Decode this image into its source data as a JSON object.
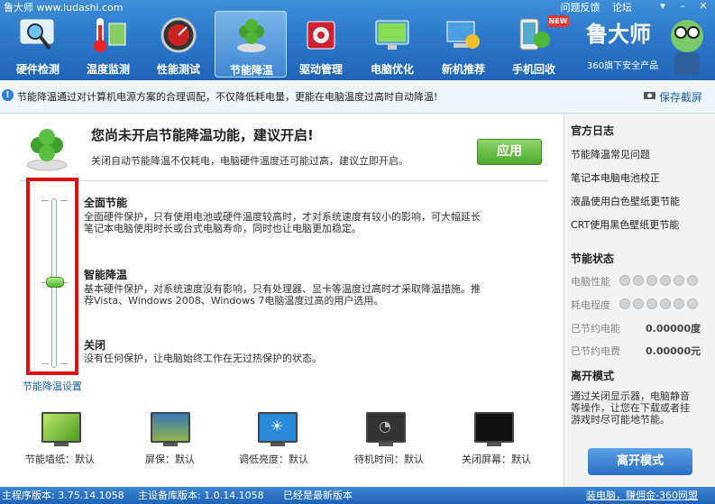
{
  "window": {
    "title": "鲁大师  www.ludashi.com",
    "top_links": [
      "问题反馈",
      "论坛"
    ]
  },
  "nav": [
    {
      "label": "硬件检测"
    },
    {
      "label": "温度监测"
    },
    {
      "label": "性能测试"
    },
    {
      "label": "节能降温",
      "active": true
    },
    {
      "label": "驱动管理"
    },
    {
      "label": "电脑优化"
    },
    {
      "label": "新机推荐"
    },
    {
      "label": "手机回收"
    }
  ],
  "badge_new": "NEW",
  "brand": {
    "name": "鲁大师",
    "sub": "360旗下安全产品"
  },
  "infobar": {
    "text": "节能降温通过对计算机电源方案的合理调配，不仅降低耗电量，更能在电脑温度过高时自动降温!",
    "screenshot": "保存截屏"
  },
  "main": {
    "headline": "您尚未开启节能降温功能，建议开启!",
    "subline": "关闭自动节能降温不仅耗电，电脑硬件温度还可能过高，建议立即开启。",
    "apply_label": "应用",
    "slider_caption": "节能降温设置",
    "slider_level": "智能降温",
    "options": [
      {
        "title": "全面节能",
        "desc1": "全面硬件保护，只有使用电池或硬件温度较高时，才对系统速度有较小的影响，可大幅延长",
        "desc2": "笔记本电脑使用时长或台式电脑寿命，同时也让电脑更加稳定。"
      },
      {
        "title": "智能降温",
        "desc1": "基本硬件保护，对系统速度没有影响，只有处理器、显卡等温度过高时才采取降温措施。推",
        "desc2": "荐Vista、Windows 2008、Windows 7电脑温度过高的用户选用。"
      },
      {
        "title": "关闭",
        "desc1": "没有任何保护，让电脑始终工作在无过热保护的状态。",
        "desc2": ""
      }
    ],
    "bottom": [
      {
        "label": "节能墙纸：默认"
      },
      {
        "label": "屏保：默认"
      },
      {
        "label": "调低亮度：默认"
      },
      {
        "label": "待机时间：默认"
      },
      {
        "label": "关闭屏幕：默认"
      }
    ]
  },
  "sidebar": {
    "official_title": "官方日志",
    "links": [
      "节能降温常见问题",
      "笔记本电脑电池校正",
      "液晶使用白色壁纸更节能",
      "CRT使用黑色壁纸更节能"
    ],
    "status_title": "节能状态",
    "perf_label": "电脑性能",
    "power_label": "耗电程度",
    "saved_power_label": "已节约电能",
    "saved_power_value": "0.00000度",
    "saved_cost_label": "已节约电费",
    "saved_cost_value": "0.00000元",
    "leave_title": "离开模式",
    "leave_text1": "通过关闭显示器，电脑静音",
    "leave_text2": "等操作，让您在下载或者挂",
    "leave_text3": "游戏时尽可能地节能。",
    "exit_label": "离开模式"
  },
  "status": {
    "main_version": "主程序版本: 3.75.14.1058",
    "lib_version": "主设备库版本: 1.0.14.1058",
    "latest": "已经是最新版本",
    "right": "装电脑，赚佣金-360网盟"
  },
  "colors": {
    "accent": "#2b77c9",
    "highlight": "#e01010",
    "apply": "#4ea82c"
  }
}
